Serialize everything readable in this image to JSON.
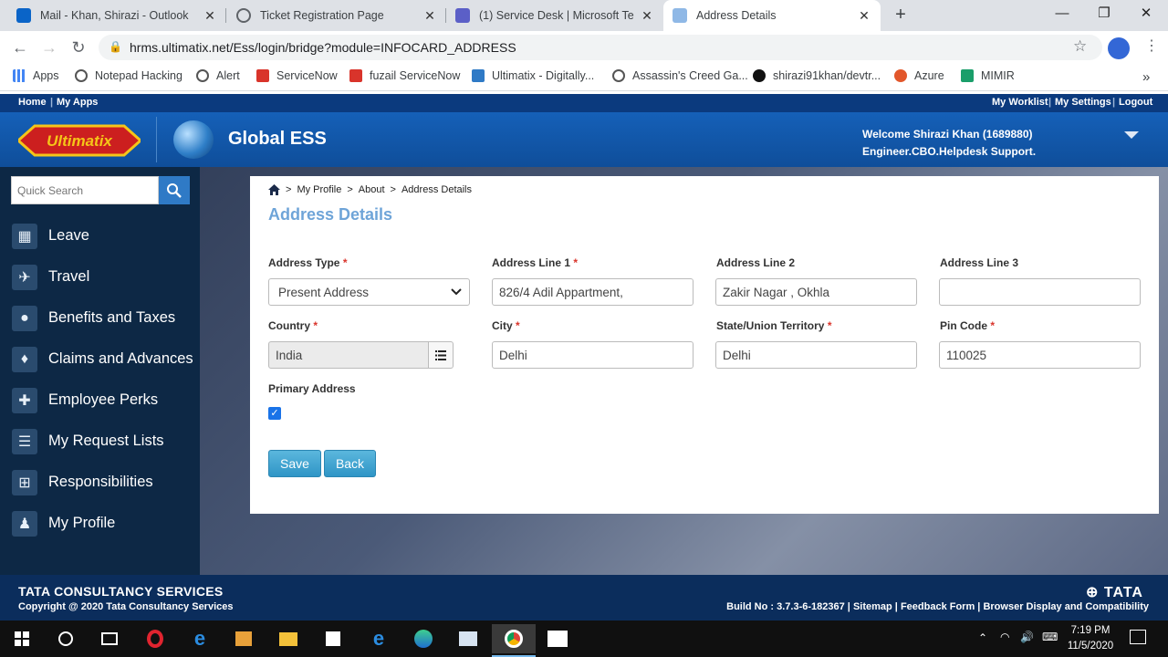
{
  "browser": {
    "tabs": [
      {
        "title": "Mail - Khan, Shirazi - Outlook",
        "icon": "outlook-icon",
        "color": "#0a64c8"
      },
      {
        "title": "Ticket Registration Page",
        "icon": "globe-icon",
        "color": "#5f6368"
      },
      {
        "title": "(1) Service Desk | Microsoft Teams",
        "icon": "teams-icon",
        "color": "#5b5fc7"
      },
      {
        "title": "Address Details",
        "icon": "ultimatix-icon",
        "color": "#2f7ac6"
      }
    ],
    "url": "hrms.ultimatix.net/Ess/login/bridge?module=INFOCARD_ADDRESS",
    "bookmarks": [
      {
        "label": "Apps",
        "color": "#4285f4"
      },
      {
        "label": "Notepad Hacking",
        "color": "#555555"
      },
      {
        "label": "Alert",
        "color": "#555555"
      },
      {
        "label": "ServiceNow",
        "color": "#d9342b"
      },
      {
        "label": "fuzail ServiceNow",
        "color": "#d9342b"
      },
      {
        "label": "Ultimatix - Digitally...",
        "color": "#2f7ac6"
      },
      {
        "label": "Assassin's Creed Ga...",
        "color": "#555555"
      },
      {
        "label": "shirazi91khan/devtr...",
        "color": "#111111"
      },
      {
        "label": "Azure",
        "color": "#e2572b"
      },
      {
        "label": "MIMIR",
        "color": "#1a9e6a"
      }
    ],
    "more_bookmarks": "»"
  },
  "header": {
    "nav_left": [
      "Home",
      "My Apps"
    ],
    "nav_right": [
      "My Worklist",
      "My Settings",
      "Logout"
    ],
    "logo_text": "Ultimatix",
    "app_name": "Global ESS",
    "welcome_line1": "Welcome Shirazi Khan (1689880)",
    "welcome_line2": "Engineer.CBO.Helpdesk Support."
  },
  "sidebar": {
    "search_placeholder": "Quick Search",
    "items": [
      {
        "label": "Leave",
        "icon": "calendar-icon"
      },
      {
        "label": "Travel",
        "icon": "airplane-icon"
      },
      {
        "label": "Benefits and Taxes",
        "icon": "piggy-bank-icon"
      },
      {
        "label": "Claims and Advances",
        "icon": "money-bag-icon"
      },
      {
        "label": "Employee Perks",
        "icon": "gift-icon"
      },
      {
        "label": "My Request Lists",
        "icon": "list-icon"
      },
      {
        "label": "Responsibilities",
        "icon": "org-chart-icon"
      },
      {
        "label": "My Profile",
        "icon": "user-icon"
      }
    ]
  },
  "breadcrumb": {
    "items": [
      "My Profile",
      "About",
      "Address Details"
    ],
    "separator": ">"
  },
  "page_title": "Address Details",
  "form": {
    "address_type_label": "Address Type",
    "address_type_value": "Present Address",
    "address_line1_label": "Address Line 1",
    "address_line1_value": "826/4 Adil Appartment,",
    "address_line2_label": "Address Line 2",
    "address_line2_value": "Zakir Nagar , Okhla",
    "address_line3_label": "Address Line 3",
    "address_line3_value": "",
    "country_label": "Country",
    "country_value": "India",
    "city_label": "City",
    "city_value": "Delhi",
    "state_label": "State/Union Territory",
    "state_value": "Delhi",
    "pin_label": "Pin Code",
    "pin_value": "110025",
    "primary_label": "Primary Address",
    "primary_checked": true,
    "required_mark": "*"
  },
  "buttons": {
    "save": "Save",
    "back": "Back"
  },
  "footer": {
    "company": "TATA CONSULTANCY SERVICES",
    "copyright": "Copyright @ 2020 Tata Consultancy Services",
    "brand": "TATA",
    "build": "Build No : 3.7.3-6-182367",
    "links": [
      "Sitemap",
      "Feedback Form",
      "Browser Display and Compatibility"
    ]
  },
  "taskbar": {
    "time": "7:19 PM",
    "date": "11/5/2020"
  },
  "colors": {
    "accent": "#2f7ac6",
    "title": "#6ea4d8",
    "nav_dark": "#0b3a7e",
    "sidebar": "#0d2845",
    "required": "#d9342b"
  }
}
